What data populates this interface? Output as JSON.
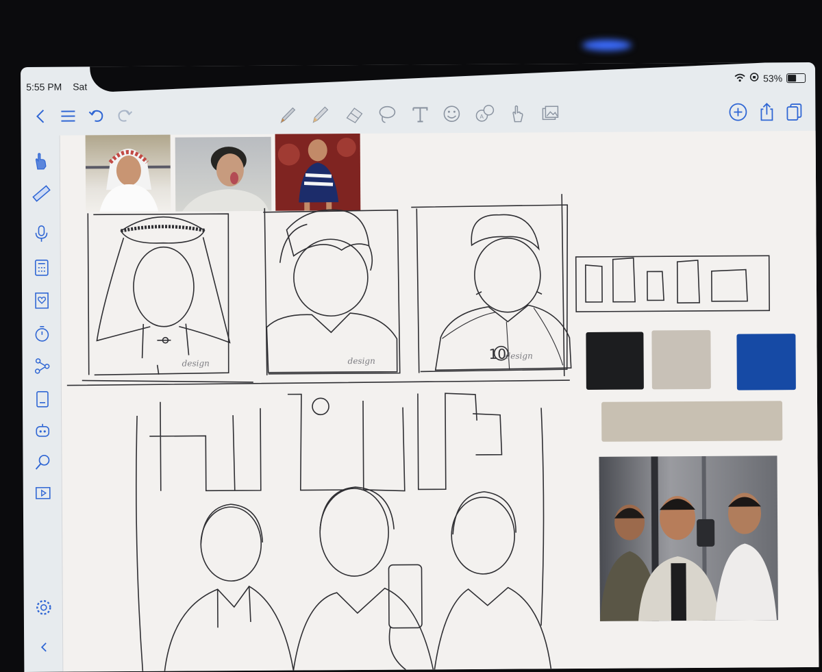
{
  "status": {
    "time": "5:55 PM",
    "day": "Sat",
    "battery": "53%"
  },
  "toolbar": {
    "left_icons": [
      "back-icon",
      "menu-icon",
      "undo-icon",
      "redo-icon"
    ],
    "tools": [
      "brush-icon",
      "pencil-icon",
      "eraser-icon",
      "lasso-icon",
      "text-tool-icon",
      "sticker-icon",
      "translate-icon",
      "hand-icon",
      "image-icon"
    ],
    "right_icons": [
      "add-icon",
      "share-icon",
      "pages-icon"
    ]
  },
  "sidebar": {
    "items": [
      "finger-draw-icon",
      "ruler-icon",
      "microphone-icon",
      "calculator-icon",
      "bookmark-heart-icon",
      "timer-icon",
      "mindmap-icon",
      "document-icon",
      "ai-robot-icon",
      "search-icon",
      "presentation-icon"
    ],
    "bottom": [
      "settings-icon",
      "collapse-icon"
    ]
  },
  "canvas": {
    "palette": {
      "black": "#1c1d1f",
      "beige": "#c8c1b7",
      "blue": "#164aa5",
      "wide_beige": "#c8c0b2"
    },
    "sketch_annotations": [
      "design",
      "design",
      "design"
    ],
    "shirt_number": "10"
  }
}
